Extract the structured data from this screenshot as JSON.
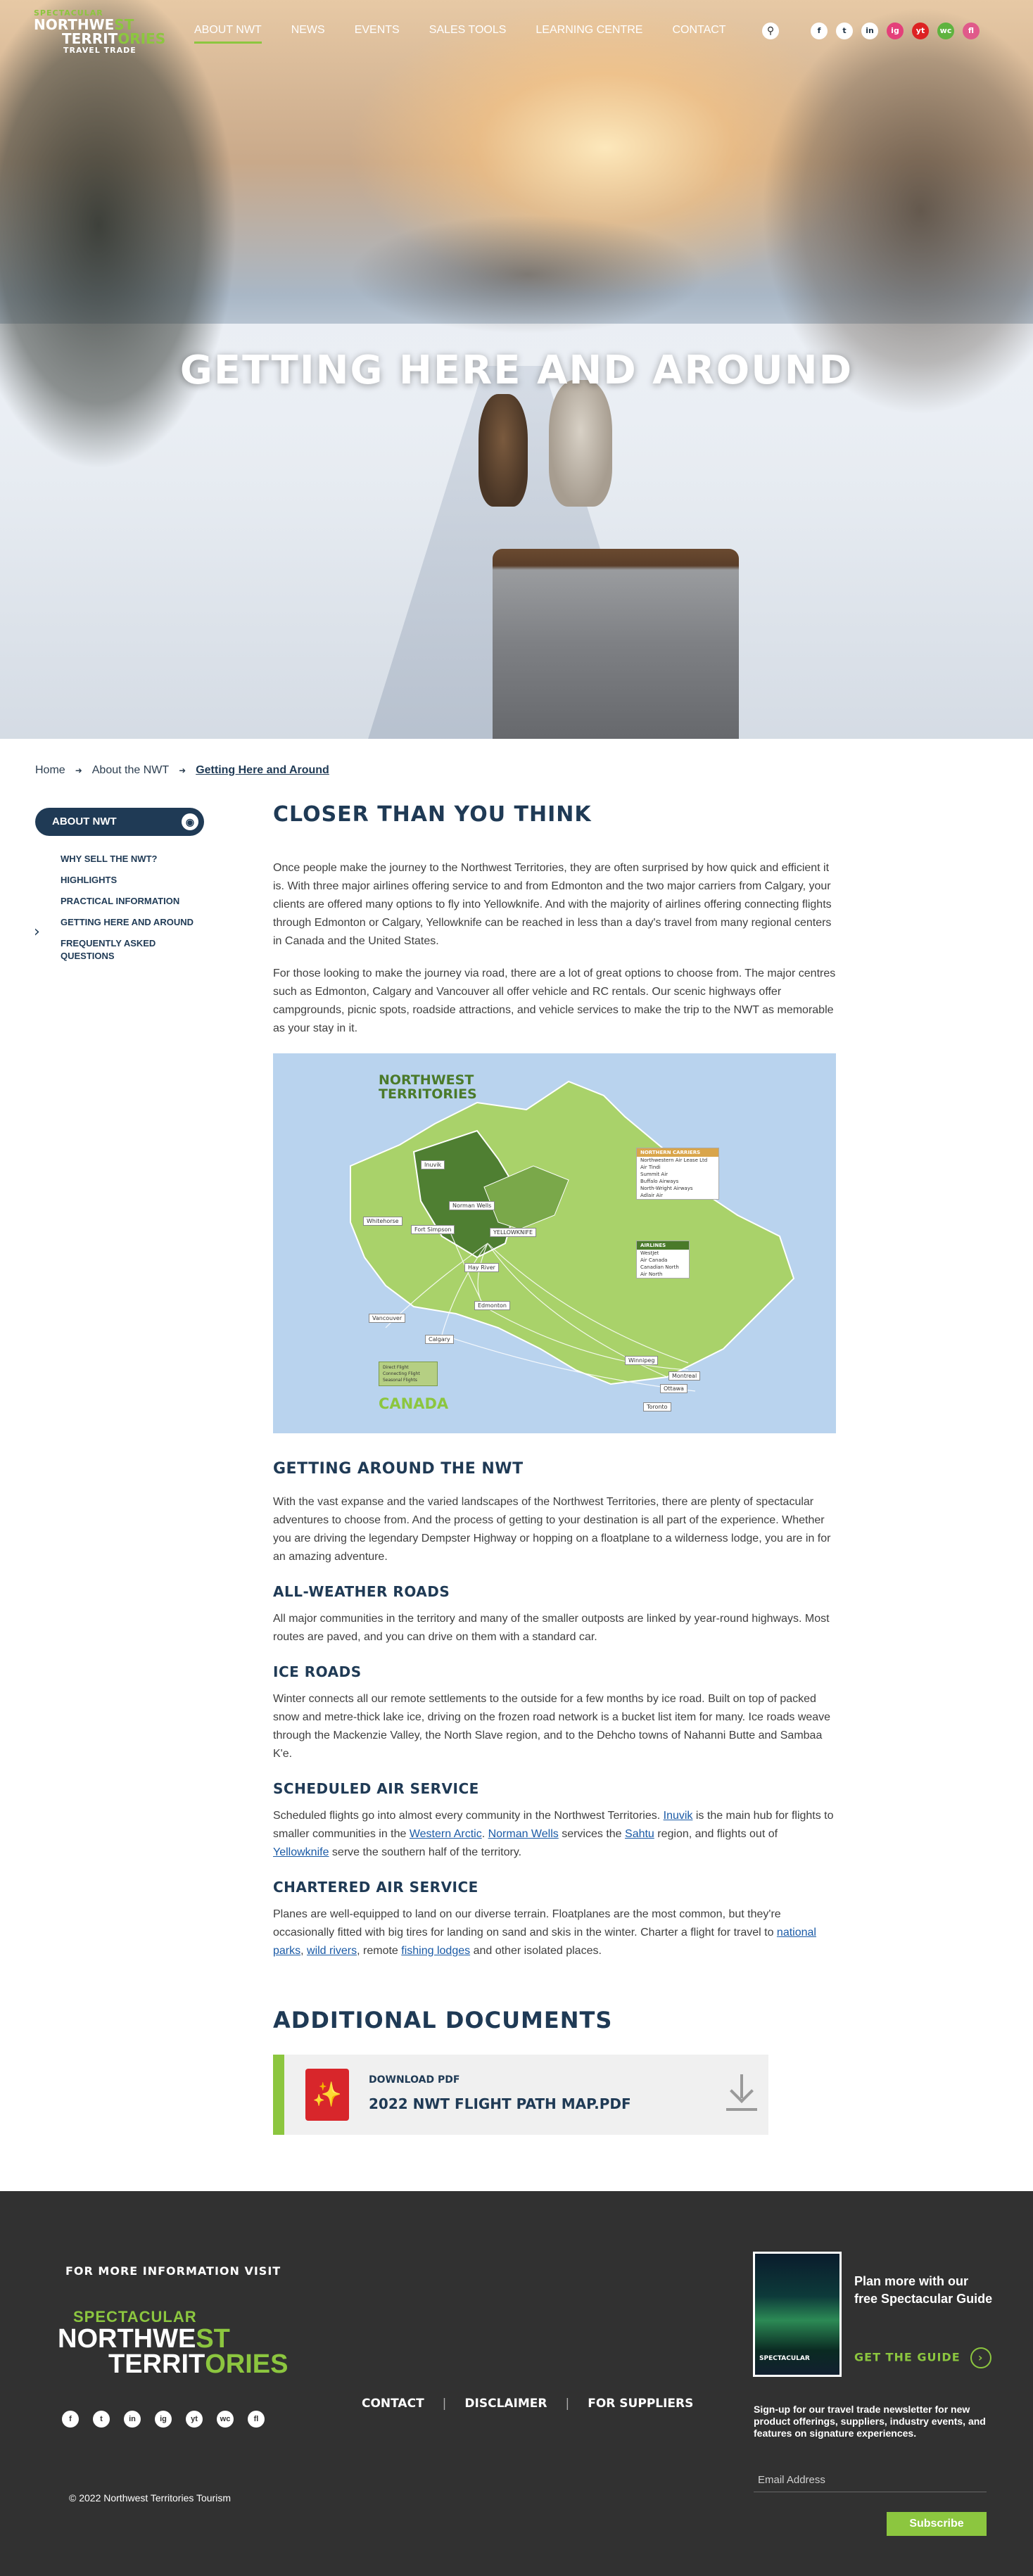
{
  "header": {
    "logo": {
      "line1": "SPECTACULAR",
      "line2a": "NORTHWE",
      "line2b": "ST",
      "line3a": "TERRIT",
      "line3b": "ORIES",
      "line4": "TRAVEL TRADE"
    },
    "nav": [
      "ABOUT NWT",
      "NEWS",
      "EVENTS",
      "SALES TOOLS",
      "LEARNING CENTRE",
      "CONTACT"
    ],
    "active_nav": "ABOUT NWT",
    "search_icon": "search-icon",
    "social": [
      "f",
      "t",
      "in",
      "ig",
      "yt",
      "wc",
      "fl"
    ]
  },
  "hero": {
    "title": "GETTING HERE AND AROUND"
  },
  "breadcrumb": {
    "items": [
      "Home",
      "About the NWT",
      "Getting Here and Around"
    ]
  },
  "sidebar": {
    "heading": "ABOUT NWT",
    "items": [
      "WHY SELL THE NWT?",
      "HIGHLIGHTS",
      "PRACTICAL INFORMATION",
      "GETTING HERE AND AROUND",
      "FREQUENTLY ASKED QUESTIONS"
    ],
    "active_index": 3
  },
  "main": {
    "title": "CLOSER THAN YOU THINK",
    "p1": "Once people make the journey to the Northwest Territories, they are often surprised by how quick and efficient it is. With three major airlines offering service to and from Edmonton and the two major carriers from Calgary, your clients are offered many options to fly into Yellowknife. And with the majority of airlines offering connecting flights through Edmonton or Calgary, Yellowknife can be reached in less than a day's travel from many regional centers in Canada and the United States.",
    "p2": "For those looking to make the journey via road, there are a lot of great options to choose from. The major centres such as Edmonton, Calgary and Vancouver all offer vehicle and RC rentals. Our scenic highways offer campgrounds, picnic spots, roadside attractions, and vehicle services to make the trip to the NWT as memorable as your stay in it.",
    "map": {
      "title_line1": "NORTHWEST",
      "title_line2": "TERRITORIES",
      "country": "CANADA",
      "cities": [
        "Inuvik",
        "Whitehorse",
        "Fort Simpson",
        "Norman Wells",
        "YELLOWKNIFE",
        "Hay River",
        "Edmonton",
        "Calgary",
        "Vancouver",
        "Winnipeg",
        "Montreal",
        "Ottawa",
        "Toronto"
      ],
      "northern_carriers": {
        "header": "NORTHERN CARRIERS",
        "items": [
          "Northwestern Air Lease Ltd",
          "Air Tindi",
          "Summit Air",
          "Buffalo Airways",
          "North-Wright Airways",
          "Adlair Air"
        ]
      },
      "airlines": {
        "header": "AIRLINES",
        "items": [
          "WestJet",
          "Air Canada",
          "Canadian North",
          "Air North"
        ]
      },
      "legend": [
        "Direct Flight",
        "Connecting Flight",
        "Seasonal Flights"
      ]
    },
    "s2_title": "GETTING AROUND THE NWT",
    "s2_p": "With the vast expanse and the varied landscapes of the Northwest Territories, there are plenty of spectacular adventures to choose from. And the process of getting to your destination is all part of the experience. Whether you are driving the legendary Dempster Highway or hopping on a floatplane to a wilderness lodge, you are in for an amazing adventure.",
    "s3_title": "ALL-WEATHER ROADS",
    "s3_p": "All major communities in the territory and many of the smaller outposts are linked by year-round highways. Most routes are paved, and you can drive on them with a standard car.",
    "s4_title": "ICE ROADS",
    "s4_p": "Winter connects all our remote settlements to the outside for a few months by ice road. Built on top of packed snow and metre-thick lake ice, driving on the frozen road network is a bucket list item for many. Ice roads weave through the Mackenzie Valley, the North Slave region, and to the Dehcho towns of Nahanni Butte and Sambaa K'e.",
    "s5_title": "SCHEDULED AIR SERVICE",
    "s5_p": {
      "t1": "Scheduled flights go into almost every community in the Northwest Territories. ",
      "l1": "Inuvik",
      "t2": " is the main hub for flights to smaller communities in the ",
      "l2": "Western Arctic",
      "t3": ". ",
      "l3": "Norman Wells",
      "t4": " services the ",
      "l4": "Sahtu",
      "t5": " region, and flights out of ",
      "l5": "Yellowknife",
      "t6": " serve the southern half of the territory."
    },
    "s6_title": "CHARTERED AIR SERVICE",
    "s6_p": {
      "t1": "Planes are well-equipped to land on our diverse terrain. Floatplanes are the most common, but they're occasionally fitted with big tires for landing on sand and skis in the winter. Charter a flight for travel to ",
      "l1": "national parks",
      "t2": ", ",
      "l2": "wild rivers",
      "t3": ", remote ",
      "l3": "fishing lodges",
      "t4": " and other isolated places."
    }
  },
  "documents": {
    "title": "ADDITIONAL DOCUMENTS",
    "kicker": "DOWNLOAD PDF",
    "file_name": "2022 NWT FLIGHT PATH MAP.PDF"
  },
  "footer": {
    "more_info": "FOR MORE INFORMATION VISIT",
    "logo": {
      "line1": "SPECTACULAR",
      "line2a": "NORTHWE",
      "line2b": "ST",
      "line3a": "TERRIT",
      "line3b": "ORIES"
    },
    "social": [
      "f",
      "t",
      "in",
      "ig",
      "yt",
      "wc",
      "fl"
    ],
    "links": [
      "CONTACT",
      "DISCLAIMER",
      "FOR SUPPLIERS"
    ],
    "copyright": "© 2022 Northwest Territories Tourism",
    "guide": {
      "cover_label": "SPECTACULAR",
      "text": "Plan more with our free Spectacular Guide",
      "cta": "GET THE GUIDE"
    },
    "newsletter": {
      "text": "Sign-up for our travel trade newsletter for new product offerings, suppliers, industry events, and features on signature experiences.",
      "email_placeholder": "Email Address",
      "subscribe": "Subscribe"
    }
  },
  "colors": {
    "brand_navy": "#1f3a55",
    "brand_green": "#8cc63f",
    "footer_bg": "#313131",
    "pdf_red": "#d8262b"
  }
}
